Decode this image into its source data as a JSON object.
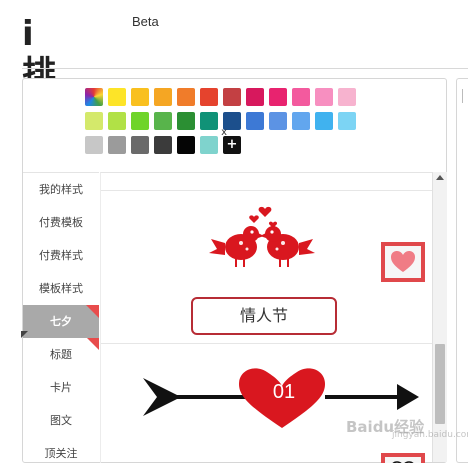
{
  "header": {
    "logo_text": "排版",
    "logo_i": "i",
    "beta_label": "Beta"
  },
  "palette": {
    "row1": [
      "rainbow",
      "#fde428",
      "#f9c01f",
      "#f5a623",
      "#f07c2a",
      "#e5432d",
      "#c34043",
      "#d7185d",
      "#e8236f",
      "#f35a9e",
      "#f78fc0",
      "#f7b3cf"
    ],
    "row2": [
      "#d4e96b",
      "#b1e146",
      "#6fd42a",
      "#58b44b",
      "#2b8f33",
      "#109277",
      "#1c4f8c",
      "#3d79d5",
      "#5c93e4",
      "#62a6ee",
      "#40b2ef",
      "#7cd4f4"
    ],
    "row3": [
      "#c7c7c7",
      "#9b9b9b",
      "#6a6a6a",
      "#3b3b3b",
      "#050505",
      "#7fd3cd",
      "plus"
    ],
    "close_label": "x",
    "plus_label": "+"
  },
  "sidebar": {
    "items": [
      {
        "label": "我的样式"
      },
      {
        "label": "付费模板"
      },
      {
        "label": "付费样式"
      },
      {
        "label": "模板样式"
      },
      {
        "label": "七夕"
      },
      {
        "label": "标题"
      },
      {
        "label": "卡片"
      },
      {
        "label": "图文"
      },
      {
        "label": "顶关注"
      }
    ],
    "active_index": 4
  },
  "content": {
    "template1": {
      "title": "情人节",
      "icon": "love-birds-icon"
    },
    "template2": {
      "number": "01",
      "icon": "arrow-heart-icon"
    },
    "favorite_icon": "heart-icon"
  },
  "colors": {
    "accent_red": "#e0484b",
    "heart_red": "#d9171f",
    "active_tab_bg": "#a9a9a9"
  },
  "watermark": {
    "text": "Baidu经验",
    "sub": "jingyan.baidu.com"
  }
}
